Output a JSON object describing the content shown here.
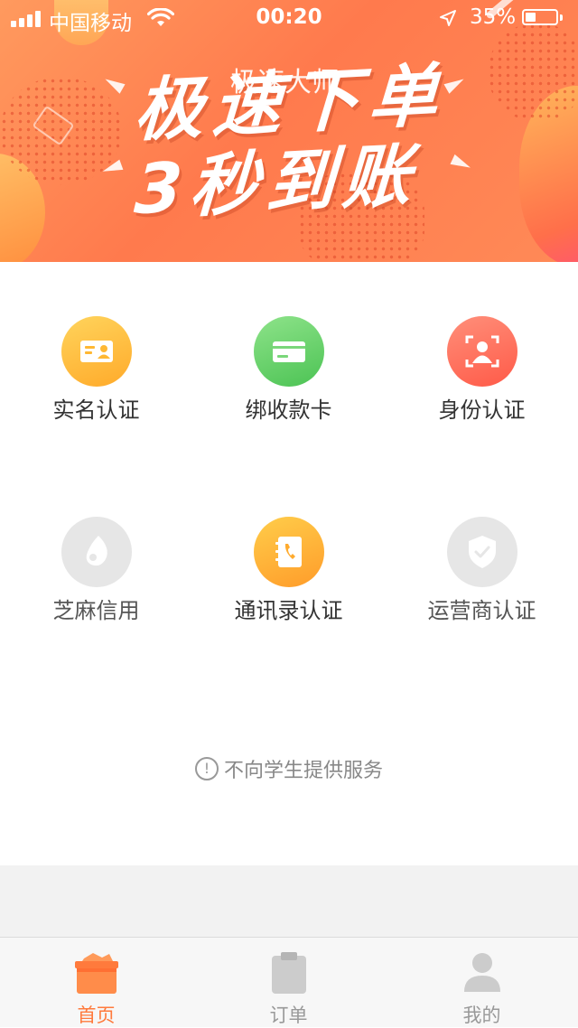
{
  "status_bar": {
    "carrier": "中国移动",
    "time": "00:20",
    "battery": "35%",
    "battery_level": 0.35
  },
  "banner": {
    "line1": "极速下单",
    "line2": "3秒到账",
    "watermark": "极速大师"
  },
  "grid": {
    "items": [
      {
        "label": "实名认证",
        "icon": "id-card-icon",
        "color": "#ffb833"
      },
      {
        "label": "绑收款卡",
        "icon": "bank-card-icon",
        "color": "#5fcd5f"
      },
      {
        "label": "身份认证",
        "icon": "face-scan-icon",
        "color": "#ff6a55"
      },
      {
        "label": "芝麻信用",
        "icon": "sesame-icon",
        "color": "#e6e6e6"
      },
      {
        "label": "通讯录认证",
        "icon": "contacts-book-icon",
        "color": "#ffab2e"
      },
      {
        "label": "运营商认证",
        "icon": "shield-check-icon",
        "color": "#e6e6e6"
      }
    ]
  },
  "notice": {
    "text": "不向学生提供服务",
    "icon": "!"
  },
  "tabbar": {
    "items": [
      {
        "label": "首页",
        "icon": "home-box-icon",
        "active": true
      },
      {
        "label": "订单",
        "icon": "clipboard-icon",
        "active": false
      },
      {
        "label": "我的",
        "icon": "user-icon",
        "active": false
      }
    ],
    "active_color": "#ff7a3c",
    "inactive_color": "#999999"
  }
}
